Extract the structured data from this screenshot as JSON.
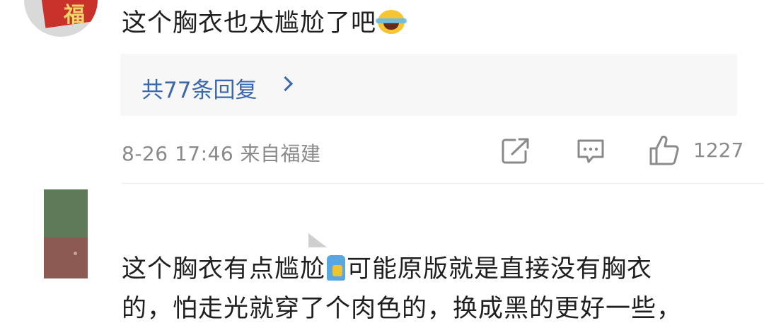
{
  "comment1": {
    "text": "这个胸衣也太尴尬了吧",
    "emoji": "laughing-tears-emoji",
    "replies_label": "共77条回复",
    "meta": "8-26 17:46 来自福建",
    "like_count": "1227",
    "avatar_glyph": "福"
  },
  "comment2": {
    "line1_a": "这个胸衣有点尴尬",
    "line1_emoji": "popsicle-emoji",
    "line1_b": "可能原版就是直接没有胸衣",
    "line2": "的，怕走光就穿了个肉色的，换成黑的更好一些，"
  },
  "icons": {
    "share": "share-icon",
    "comment": "comment-icon",
    "like": "thumbs-up-icon",
    "chevron": "chevron-right-icon"
  },
  "colors": {
    "link": "#3b68ad",
    "meta": "#8a8a8a",
    "text": "#1f1f1f",
    "reply_bg": "#f7f7f7"
  }
}
